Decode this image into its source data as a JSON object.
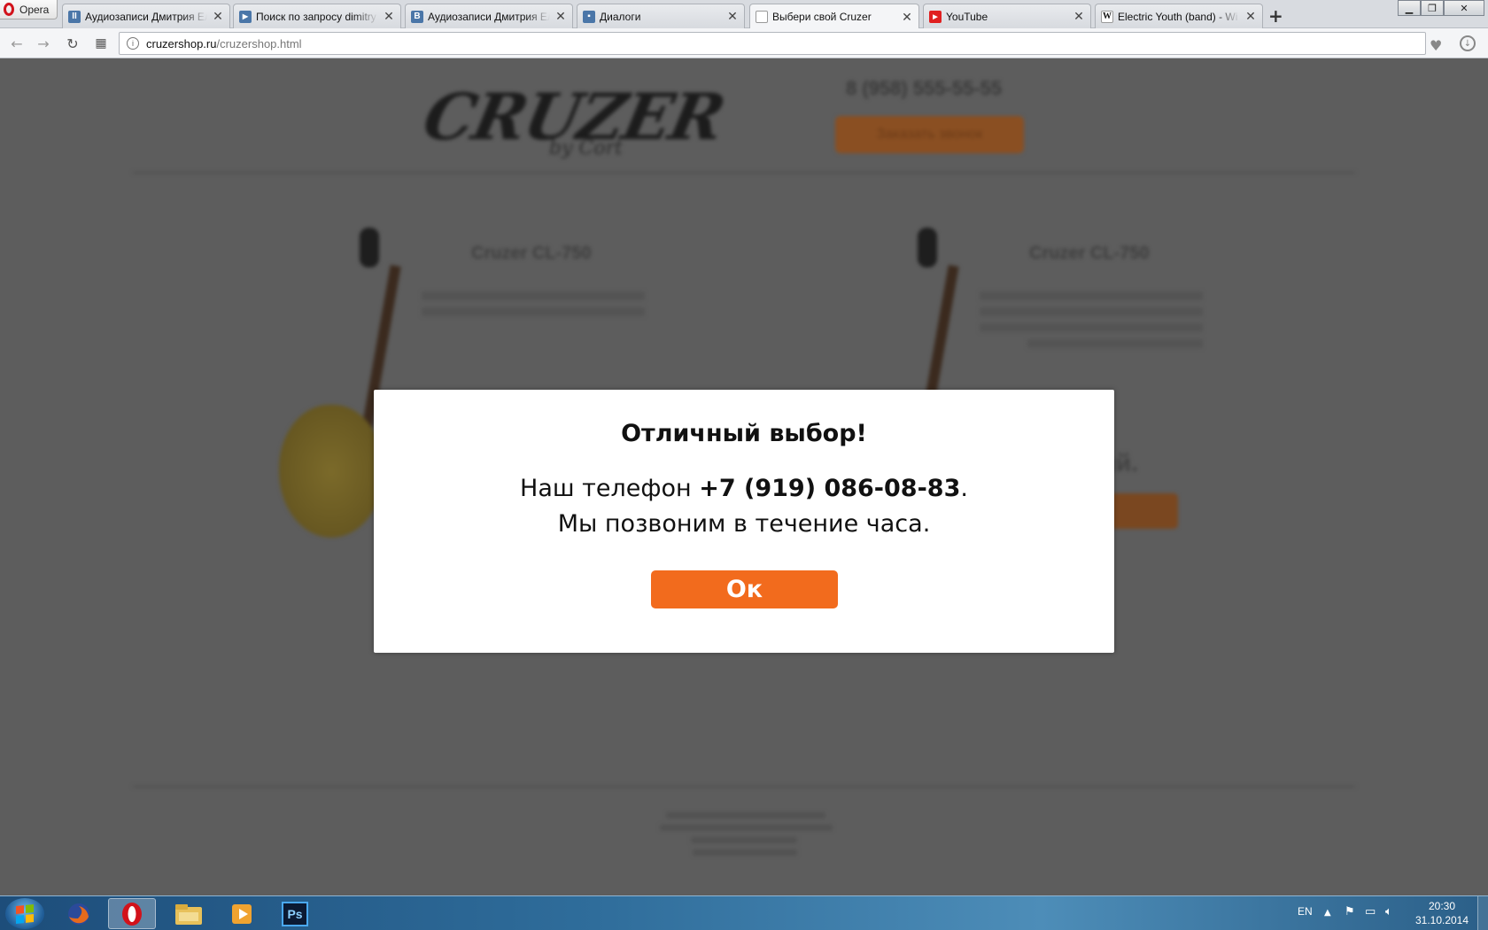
{
  "browser": {
    "menu_label": "Opera",
    "tabs": [
      {
        "title": "Аудиозаписи Дмитрия Ел",
        "favicon": "vk-audio-icon",
        "color": "#4a76a8",
        "glyph": "II"
      },
      {
        "title": "Поиск по запросу dimitry",
        "favicon": "video-icon",
        "color": "#4a76a8",
        "glyph": "▶"
      },
      {
        "title": "Аудиозаписи Дмитрия Ел",
        "favicon": "vk-icon",
        "color": "#4a76a8",
        "glyph": "B"
      },
      {
        "title": "Диалоги",
        "favicon": "dialogs-icon",
        "color": "#4a76a8",
        "glyph": "▪"
      },
      {
        "title": "Выбери свой Cruzer",
        "favicon": "page-icon",
        "color": "#ffffff",
        "glyph": "▯"
      },
      {
        "title": "YouTube",
        "favicon": "youtube-icon",
        "color": "#e02020",
        "glyph": "▶"
      },
      {
        "title": "Electric Youth (band) - Wi",
        "favicon": "wikipedia-icon",
        "color": "#ffffff",
        "glyph": "W"
      }
    ],
    "active_tab": 4,
    "url_domain": "cruzershop.ru",
    "url_path": "/cruzershop.html"
  },
  "site": {
    "logo_text": "CRUZER",
    "logo_sub": "by Cort",
    "phone": "8 (958) 555-55-55",
    "header_button": "Заказать звонок",
    "products": [
      {
        "title": "Cruzer CL-750"
      },
      {
        "title": "Cruzer CL-750"
      }
    ],
    "right_fragment": "ый."
  },
  "modal": {
    "title": "Отличный выбор!",
    "line1_prefix": "Наш телефон ",
    "phone": "+7 (919) 086-08-83",
    "line1_suffix": ".",
    "line2": "Мы позвоним в течение часа.",
    "ok_label": "Ок",
    "accent": "#f26b1d"
  },
  "taskbar": {
    "apps": [
      "firefox-icon",
      "opera-icon",
      "explorer-icon",
      "media-player-icon",
      "photoshop-icon"
    ],
    "ps_label": "Ps",
    "language": "EN",
    "time": "20:30",
    "date": "31.10.2014"
  }
}
